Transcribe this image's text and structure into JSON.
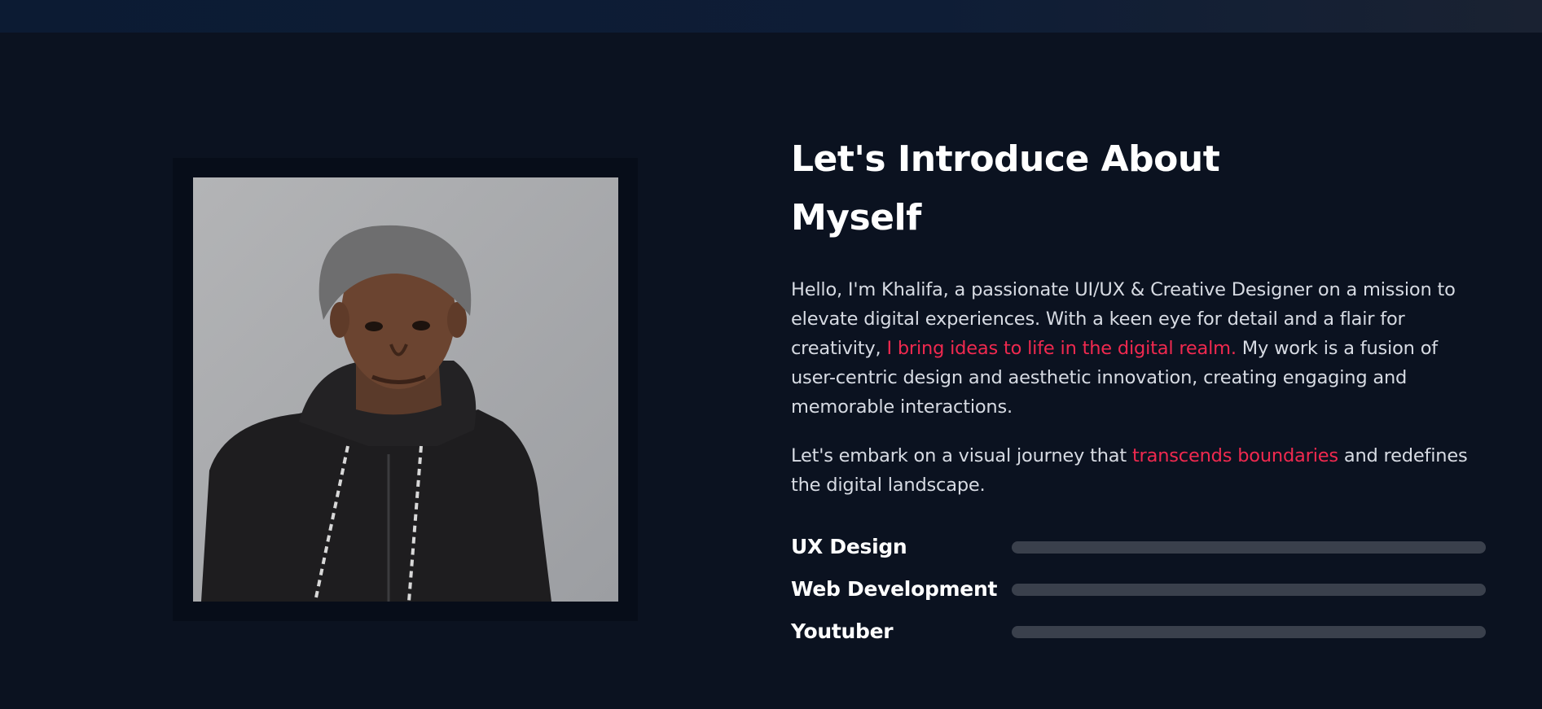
{
  "about": {
    "title_line1": "Let's Introduce About",
    "title_line2": "Myself",
    "intro_part1": "Hello, I'm Khalifa, a passionate UI/UX & Creative Designer on a mission to elevate digital experiences. With a keen eye for detail and a flair for creativity, ",
    "intro_highlight": "I bring ideas to life in the digital realm.",
    "intro_part2": " My work is a fusion of user-centric design and aesthetic innovation, creating engaging and memorable interactions.",
    "outro_part1": "Let's embark on a visual journey that ",
    "outro_highlight": "transcends boundaries",
    "outro_part2": " and redefines the digital landscape."
  },
  "skills": [
    {
      "label": "UX Design",
      "progress": 0
    },
    {
      "label": "Web Development",
      "progress": 0
    },
    {
      "label": "Youtuber",
      "progress": 0
    }
  ],
  "colors": {
    "background": "#0b1220",
    "accent": "#f0294f",
    "track": "#3a404c",
    "text": "#ffffff",
    "muted_text": "#d7dbe3"
  },
  "photo": {
    "icon": "portrait-photo"
  }
}
